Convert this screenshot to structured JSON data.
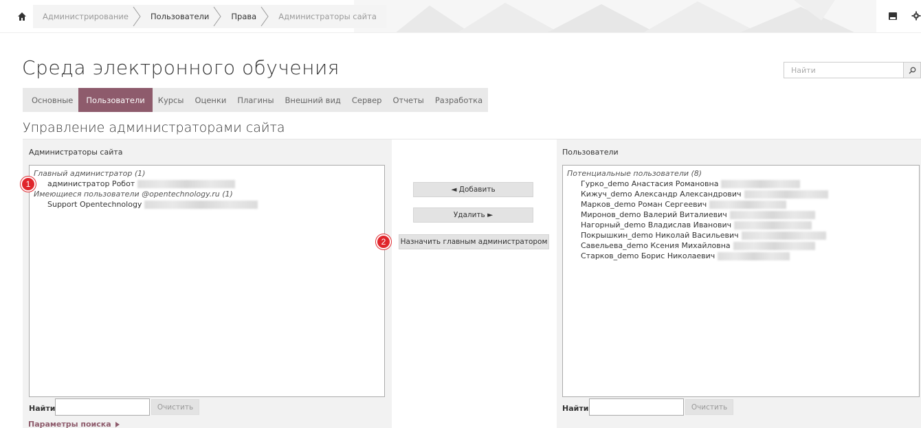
{
  "breadcrumb": [
    {
      "label": "Администрирование",
      "style": "muted"
    },
    {
      "label": "Пользователи",
      "style": "dark"
    },
    {
      "label": "Права",
      "style": "dark"
    },
    {
      "label": "Администраторы сайта",
      "style": "muted"
    }
  ],
  "site_title": "Среда электронного обучения",
  "search": {
    "placeholder": "Найти"
  },
  "tabs": [
    {
      "label": "Основные",
      "active": false
    },
    {
      "label": "Пользователи",
      "active": true
    },
    {
      "label": "Курсы",
      "active": false
    },
    {
      "label": "Оценки",
      "active": false
    },
    {
      "label": "Плагины",
      "active": false
    },
    {
      "label": "Внешний вид",
      "active": false
    },
    {
      "label": "Сервер",
      "active": false
    },
    {
      "label": "Отчеты",
      "active": false
    },
    {
      "label": "Разработка",
      "active": false
    }
  ],
  "section_title": "Управление администраторами сайта",
  "left_panel": {
    "label": "Администраторы сайта",
    "groups": [
      {
        "title": "Главный администратор (1)",
        "items": [
          "администратор Робот"
        ]
      },
      {
        "title": "Имеющиеся пользователи @opentechnology.ru (1)",
        "items": [
          "Support Opentechnology"
        ]
      }
    ],
    "find_label": "Найти",
    "clear_label": "Очистить",
    "search_params_label": "Параметры поиска"
  },
  "actions": {
    "add_label": "◄ Добавить",
    "remove_label": "Удалить ►",
    "make_main_label": "Назначить главным администратором"
  },
  "right_panel": {
    "label": "Пользователи",
    "group_title": "Потенциальные пользователи (8)",
    "items": [
      "Гурко_demo Анастасия Романовна",
      "Кижуч_demo Александр Александрович",
      "Марков_demo Роман Сергеевич",
      "Миронов_demo Валерий Виталиевич",
      "Нагорный_demo Владислав Иванович",
      "Покрышкин_demo Николай Васильевич",
      "Савельева_demo Ксения Михайловна",
      "Старков_demo Борис Николаевич"
    ],
    "find_label": "Найти",
    "clear_label": "Очистить"
  },
  "markers": [
    "1",
    "2"
  ],
  "colors": {
    "accent": "#8e5b6c",
    "marker": "#e0252b",
    "panel_bg": "#f2f2f2"
  }
}
